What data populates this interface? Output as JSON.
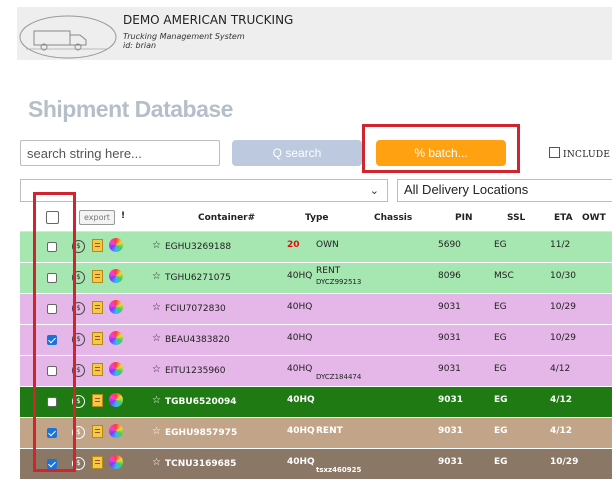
{
  "header": {
    "company": "DEMO AMERICAN TRUCKING",
    "subtitle": "Trucking Management System",
    "user_id": "id: brian"
  },
  "page_title": "Shipment Database",
  "search": {
    "placeholder": "search string here...",
    "search_button": "Q search",
    "batch_button": "% batch...",
    "include_label": "INCLUDE C"
  },
  "filters": {
    "left_select_value": "",
    "delivery_locations": "All Delivery Locations"
  },
  "table": {
    "export_label": "export",
    "excl": "!",
    "columns": {
      "container": "Container#",
      "type": "Type",
      "chassis": "Chassis",
      "pin": "PIN",
      "ssl": "SSL",
      "eta": "ETA",
      "owt": "OWT"
    },
    "rows": [
      {
        "checked": false,
        "bg": "#a6e6b0",
        "fg": "#222222",
        "container": "EGHU3269188",
        "type": "20",
        "type_color": "#e01010",
        "chassis": "OWN",
        "chassis2": "",
        "pin": "5690",
        "ssl": "EG",
        "eta": "11/2"
      },
      {
        "checked": false,
        "bg": "#a6e6b0",
        "fg": "#222222",
        "container": "TGHU6271075",
        "type": "40HQ",
        "type_color": "",
        "chassis": "RENT",
        "chassis2": "DYCZ992513",
        "pin": "8096",
        "ssl": "MSC",
        "eta": "10/30"
      },
      {
        "checked": false,
        "bg": "#e5b6e8",
        "fg": "#222222",
        "container": "FCIU7072830",
        "type": "40HQ",
        "type_color": "",
        "chassis": "",
        "chassis2": "",
        "pin": "9031",
        "ssl": "EG",
        "eta": "10/29"
      },
      {
        "checked": true,
        "bg": "#e5b6e8",
        "fg": "#222222",
        "container": "BEAU4383820",
        "type": "40HQ",
        "type_color": "",
        "chassis": "",
        "chassis2": "",
        "pin": "9031",
        "ssl": "EG",
        "eta": "10/29"
      },
      {
        "checked": false,
        "bg": "#e5b6e8",
        "fg": "#222222",
        "container": "EITU1235960",
        "type": "40HQ",
        "type_color": "",
        "chassis": "",
        "chassis2": "DYCZ184474",
        "pin": "9031",
        "ssl": "EG",
        "eta": "4/12"
      },
      {
        "checked": false,
        "bg": "#1f7a13",
        "fg": "#ffffff",
        "container": "TGBU6520094",
        "type": "40HQ",
        "type_color": "",
        "chassis": "",
        "chassis2": "",
        "pin": "9031",
        "ssl": "EG",
        "eta": "4/12"
      },
      {
        "checked": true,
        "bg": "#c2a588",
        "fg": "#ffffff",
        "container": "EGHU9857975",
        "type": "40HQ",
        "type_color": "",
        "chassis": "RENT",
        "chassis2": "",
        "pin": "9031",
        "ssl": "EG",
        "eta": "4/12"
      },
      {
        "checked": true,
        "bg": "#8a7765",
        "fg": "#ffffff",
        "container": "TCNU3169685",
        "type": "40HQ",
        "type_color": "",
        "chassis": "",
        "chassis2": "tsxz460925",
        "pin": "9031",
        "ssl": "EG",
        "eta": "10/29"
      }
    ]
  }
}
